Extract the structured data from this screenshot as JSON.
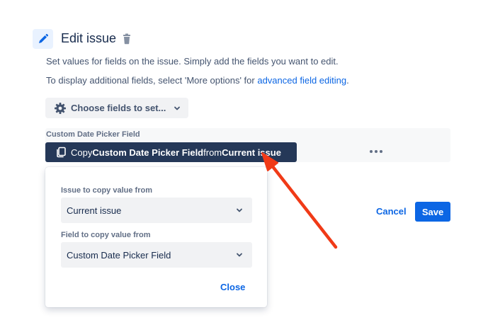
{
  "header": {
    "title": "Edit issue",
    "icon": "pencil-icon",
    "delete_icon": "trash-icon"
  },
  "description": {
    "line1": "Set values for fields on the issue. Simply add the fields you want to edit.",
    "line2_prefix": "To display additional fields, select 'More options' for ",
    "line2_link": "advanced field editing",
    "line2_suffix": "."
  },
  "choose_fields": {
    "label": "Choose fields to set...",
    "icon": "gear-icon"
  },
  "field": {
    "label": "Custom Date Picker Field",
    "copy_button": {
      "prefix": "Copy ",
      "field_name": "Custom Date Picker Field",
      "middle": " from ",
      "source": "Current issue"
    },
    "more_icon": "more-icon"
  },
  "popup": {
    "issue_label": "Issue to copy value from",
    "issue_value": "Current issue",
    "field_label": "Field to copy value from",
    "field_value": "Custom Date Picker Field",
    "close_label": "Close"
  },
  "actions": {
    "cancel_label": "Cancel",
    "save_label": "Save"
  },
  "colors": {
    "accent": "#0c66e4",
    "copy_button_bg": "#253858",
    "annotation_arrow": "#f03a17"
  }
}
